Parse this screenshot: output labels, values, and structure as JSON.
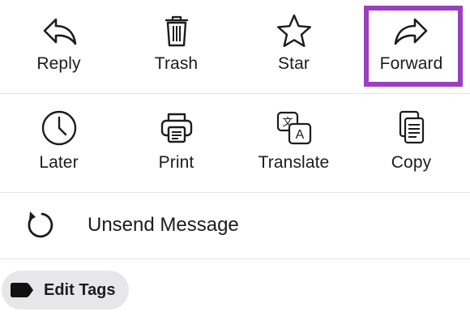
{
  "actions_row1": [
    {
      "label": "Reply",
      "icon": "reply-icon"
    },
    {
      "label": "Trash",
      "icon": "trash-icon"
    },
    {
      "label": "Star",
      "icon": "star-icon"
    },
    {
      "label": "Forward",
      "icon": "forward-icon"
    }
  ],
  "actions_row2": [
    {
      "label": "Later",
      "icon": "clock-icon"
    },
    {
      "label": "Print",
      "icon": "printer-icon"
    },
    {
      "label": "Translate",
      "icon": "translate-icon"
    },
    {
      "label": "Copy",
      "icon": "copy-icon"
    }
  ],
  "unsend": {
    "label": "Unsend Message",
    "icon": "undo-arrow-icon"
  },
  "tags": {
    "label": "Edit Tags",
    "icon": "tag-icon"
  },
  "colors": {
    "highlight": "#9b3fbf",
    "divider": "#e3e3e6",
    "pill_background": "#e7e7ea",
    "text": "#1c1c1e"
  }
}
